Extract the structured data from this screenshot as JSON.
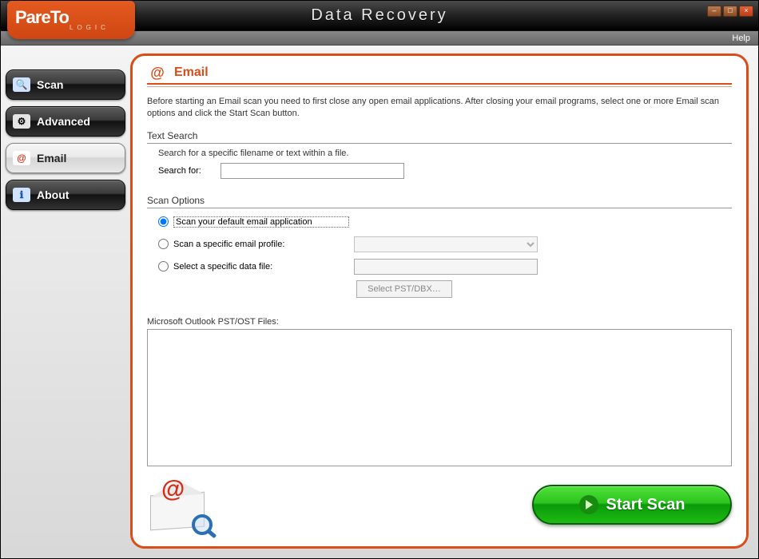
{
  "brand": {
    "line1": "PareTo",
    "line2": "LOGIC"
  },
  "app_title": "Data Recovery",
  "help_menu": "Help",
  "window_controls": {
    "minimize": "–",
    "maximize": "□",
    "close": "×"
  },
  "sidebar": {
    "items": [
      {
        "label": "Scan",
        "icon": "drive-scan-icon",
        "active": false
      },
      {
        "label": "Advanced",
        "icon": "drive-advanced-icon",
        "active": false
      },
      {
        "label": "Email",
        "icon": "email-scan-icon",
        "active": true
      },
      {
        "label": "About",
        "icon": "info-icon",
        "active": false
      }
    ]
  },
  "panel": {
    "title": "Email",
    "intro": "Before starting an Email scan you need to first close any open email applications. After closing your email programs, select one or more Email scan options and click the Start Scan button.",
    "text_search": {
      "heading": "Text Search",
      "hint": "Search for a specific filename or text within a file.",
      "label": "Search for:",
      "value": ""
    },
    "scan_options": {
      "heading": "Scan Options",
      "options": [
        {
          "label": "Scan your default email application",
          "checked": true
        },
        {
          "label": "Scan a specific email profile:",
          "checked": false,
          "profile_value": ""
        },
        {
          "label": "Select a specific data file:",
          "checked": false,
          "file_value": ""
        }
      ],
      "select_file_button": "Select PST/DBX…"
    },
    "pst_list": {
      "label": "Microsoft Outlook PST/OST Files:"
    },
    "start_button": "Start Scan"
  }
}
